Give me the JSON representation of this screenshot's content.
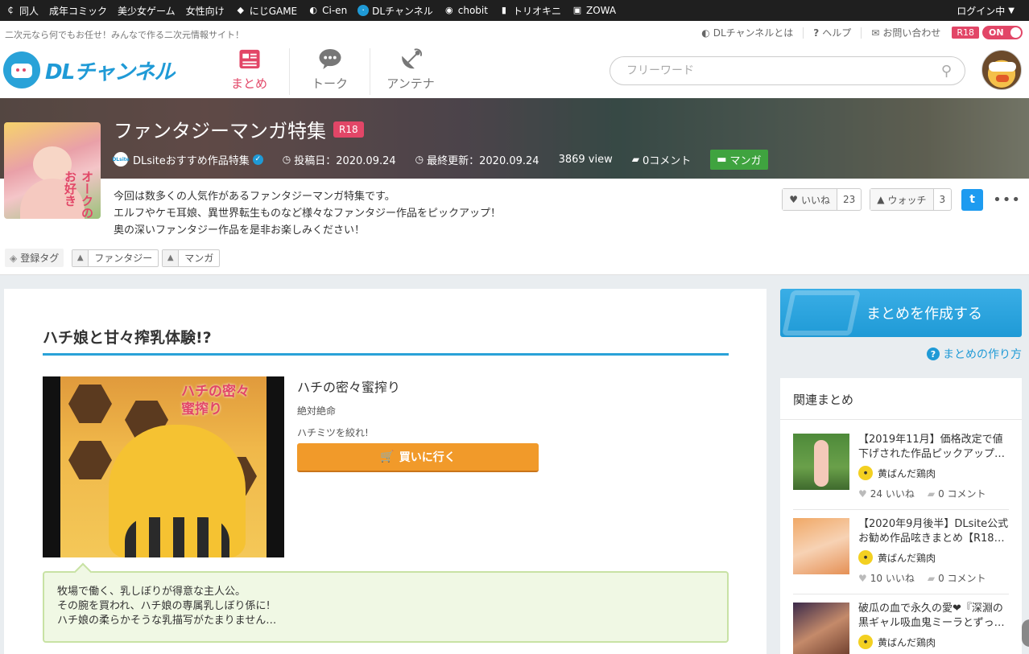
{
  "topnav": {
    "items": [
      "同人",
      "成年コミック",
      "美少女ゲーム",
      "女性向け",
      "にじGAME",
      "Ci-en",
      "DLチャンネル",
      "chobit",
      "トリオキニ",
      "ZOWA"
    ],
    "login": "ログイン中"
  },
  "header": {
    "tagline": "二次元なら何でもお任せ！みんなで作る二次元情報サイト！",
    "util_about": "DLチャンネルとは",
    "util_help": "ヘルプ",
    "util_contact": "お問い合わせ",
    "r18_label": "R18",
    "r18_toggle": "ON",
    "logo_text": "DLチャンネル",
    "nav": [
      "まとめ",
      "トーク",
      "アンテナ"
    ],
    "search_placeholder": "フリーワード"
  },
  "article_header": {
    "title": "ファンタジーマンガ特集",
    "rating": "R18",
    "author": "DLsiteおすすめ作品特集",
    "author_logo": "DLsite",
    "posted": "投稿日：2020.09.24",
    "updated": "最終更新：2020.09.24",
    "views": "3869 view",
    "comments": "0コメント",
    "category": "マンガ",
    "thumb_text": "オークのお好き",
    "description": [
      "今回は数多くの人気作があるファンタジーマンガ特集です。",
      "エルフやケモ耳娘、異世界転生ものなど様々なファンタジー作品をピックアップ！",
      "奥の深いファンタジー作品を是非お楽しみください！"
    ],
    "like_label": "いいね",
    "like_count": "23",
    "watch_label": "ウォッチ",
    "watch_count": "3",
    "tags_label": "登録タグ",
    "tags": [
      "ファンタジー",
      "マンガ"
    ]
  },
  "section": {
    "title": "ハチ娘と甘々搾乳体験!?",
    "work_title": "ハチの密々蜜搾り",
    "circle": "絶対絶命",
    "catch": "ハチミツを絞れ!",
    "buy_label": "買いに行く",
    "cover_title": "ハチの密々蜜搾り",
    "note": [
      "牧場で働く、乳しぼりが得意な主人公。",
      "その腕を買われ、ハチ娘の専属乳しぼり係に!",
      "ハチ娘の柔らかそうな乳描写がたまりません…"
    ]
  },
  "sidebar": {
    "create_label": "まとめを作成する",
    "howto_label": "まとめの作り方",
    "related_title": "関連まとめ",
    "related": [
      {
        "title": "【2019年11月】価格改定で値下げされた作品ピックアップ…",
        "author": "黄ばんだ鶏肉",
        "likes": "24 いいね",
        "comments": "0 コメント"
      },
      {
        "title": "【2020年9月後半】DLsite公式お勧め作品呟きまとめ【R18…",
        "author": "黄ばんだ鶏肉",
        "likes": "10 いいね",
        "comments": "0 コメント"
      },
      {
        "title": "破瓜の血で永久の愛❤『深淵の黒ギャル吸血鬼ミーラとずっ…",
        "author": "黄ばんだ鶏肉",
        "likes": "",
        "comments": ""
      }
    ]
  },
  "colors": {
    "brand": "#1f9ad6",
    "r18": "#e24667",
    "buy": "#f19a2a",
    "category": "#3fa33f"
  }
}
